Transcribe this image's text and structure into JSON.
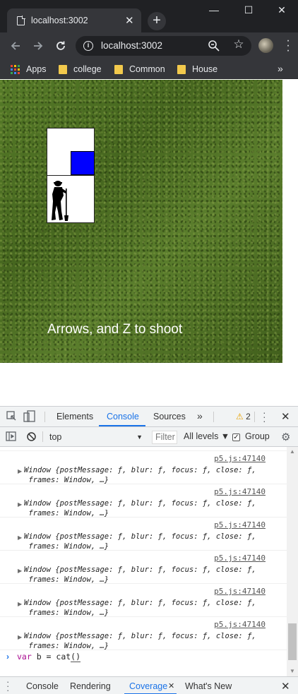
{
  "browser": {
    "tab_title": "localhost:3002",
    "tab_close": "✕",
    "new_tab": "+",
    "url": "localhost:3002",
    "window_controls": {
      "minimize": "—",
      "maximize": "☐",
      "close": "✕"
    },
    "bookmarks": [
      {
        "label": "Apps",
        "icon": "apps-grid-icon"
      },
      {
        "label": "college",
        "icon": "folder-icon"
      },
      {
        "label": "Common",
        "icon": "folder-icon"
      },
      {
        "label": "House",
        "icon": "folder-icon"
      }
    ],
    "bookmarks_overflow": "»"
  },
  "game": {
    "hint": "Arrows, and Z to shoot",
    "colors": {
      "grass": "#4a6b22",
      "box": "#0000ff",
      "panel": "#ffffff"
    }
  },
  "devtools": {
    "tabs": [
      "Elements",
      "Console",
      "Sources"
    ],
    "more_tabs": "»",
    "active_tab": "Console",
    "warning_count": "2",
    "context": "top",
    "filter_placeholder": "Filter",
    "levels": "All levels ▼",
    "group_label": "Group",
    "log_entries": [
      {
        "source": "p5.js:47140",
        "line1": "Window {postMessage: ƒ, blur: ƒ, focus: ƒ, close: ƒ,",
        "line2": " frames: Window, …}"
      },
      {
        "source": "p5.js:47140",
        "line1": "Window {postMessage: ƒ, blur: ƒ, focus: ƒ, close: ƒ,",
        "line2": " frames: Window, …}"
      },
      {
        "source": "p5.js:47140",
        "line1": "Window {postMessage: ƒ, blur: ƒ, focus: ƒ, close: ƒ,",
        "line2": " frames: Window, …}"
      },
      {
        "source": "p5.js:47140",
        "line1": "Window {postMessage: ƒ, blur: ƒ, focus: ƒ, close: ƒ,",
        "line2": " frames: Window, …}"
      },
      {
        "source": "p5.js:47140",
        "line1": "Window {postMessage: ƒ, blur: ƒ, focus: ƒ, close: ƒ,",
        "line2": " frames: Window, …}"
      },
      {
        "source": "p5.js:47140",
        "line1": "Window {postMessage: ƒ, blur: ƒ, focus: ƒ, close: ƒ,",
        "line2": " frames: Window, …}"
      }
    ],
    "prompt": {
      "keyword": "var",
      "rest": " b = cat",
      "parens": "()"
    },
    "drawer_tabs": [
      "Console",
      "Rendering",
      "Coverage",
      "What's New"
    ],
    "active_drawer_tab": "Coverage"
  }
}
